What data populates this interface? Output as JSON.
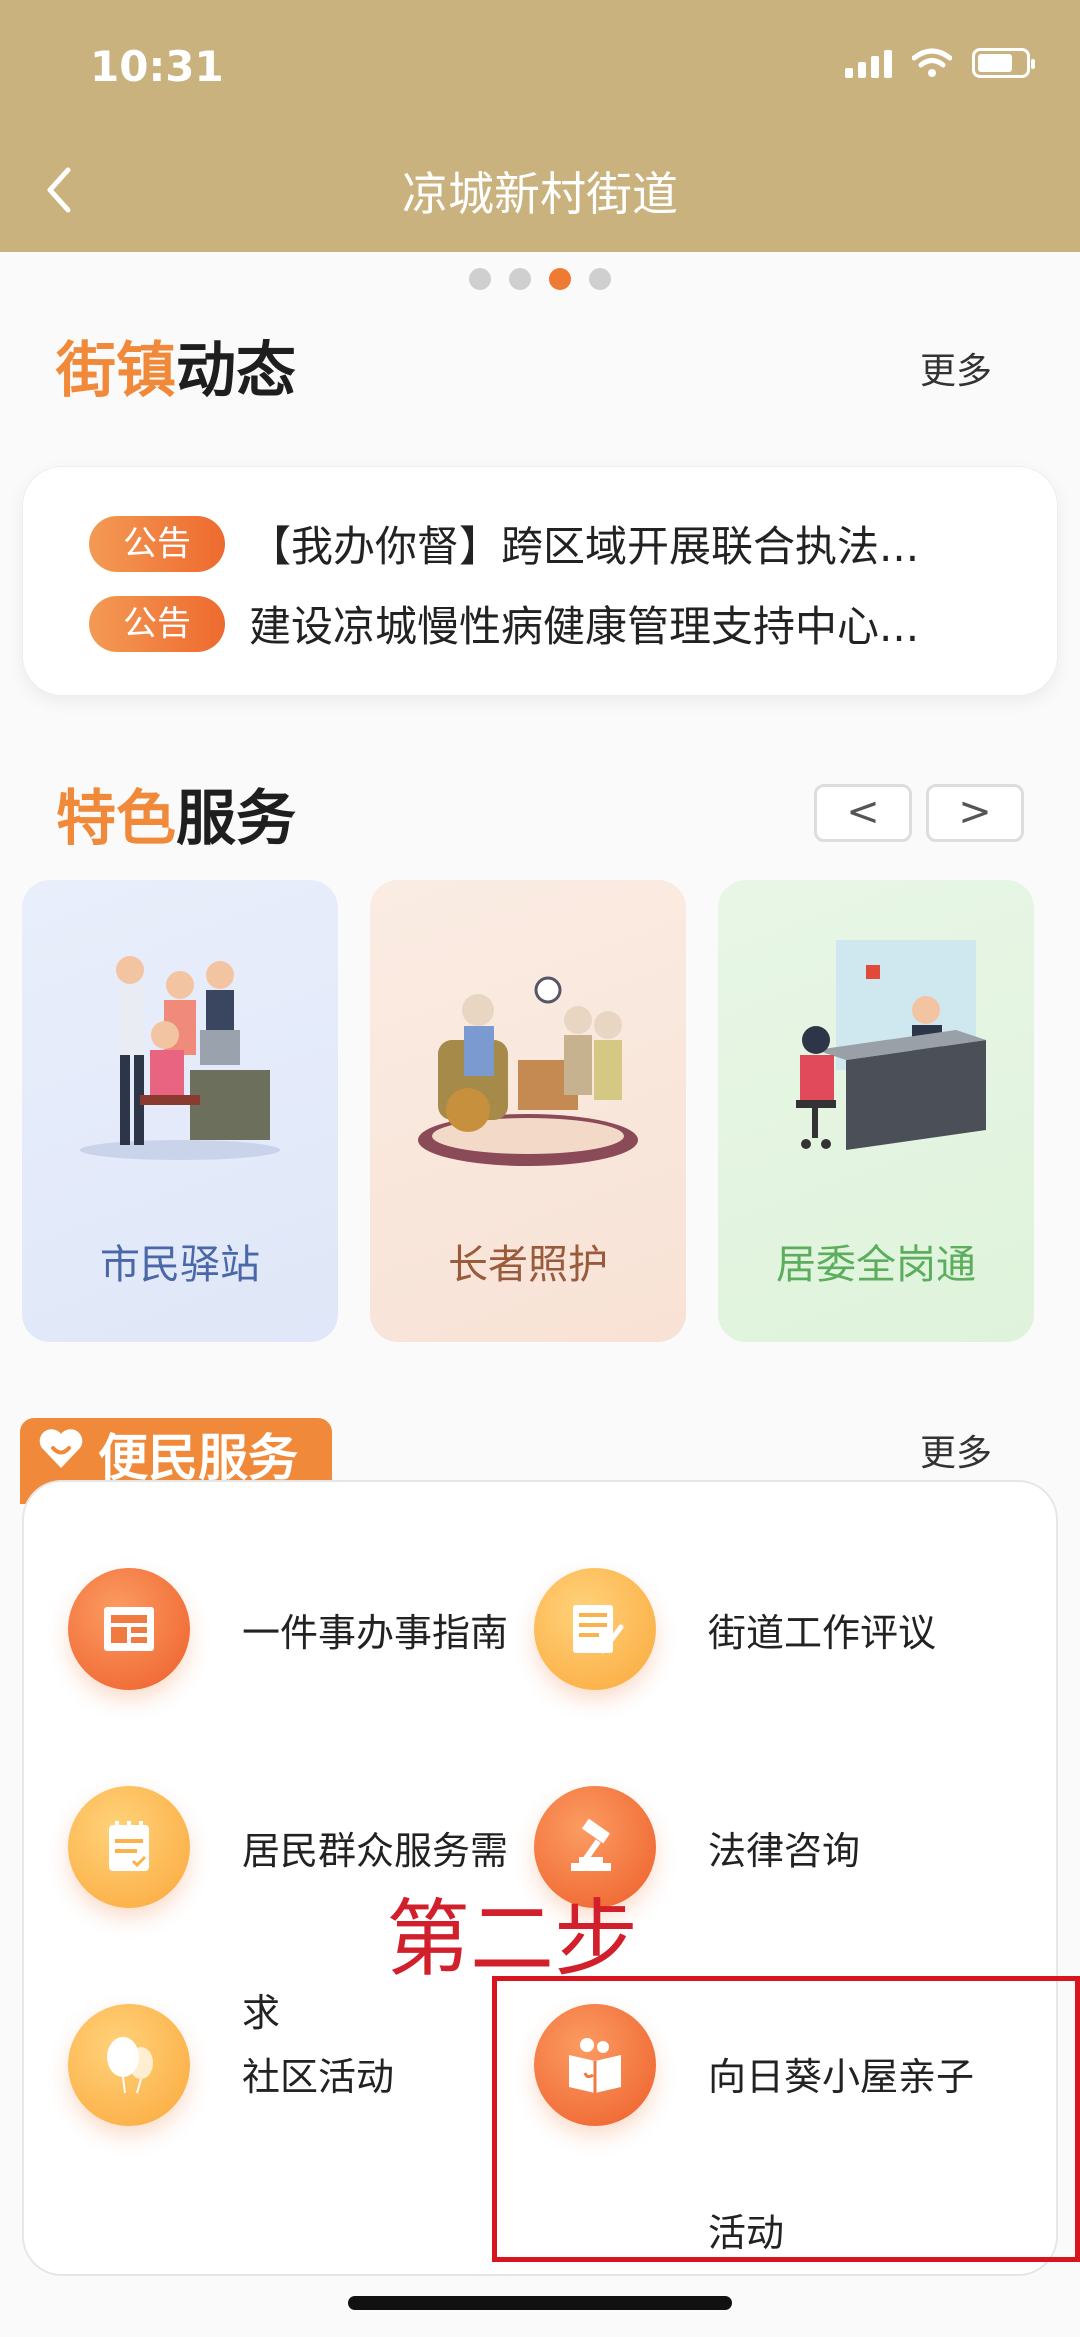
{
  "status_bar": {
    "time": "10:31"
  },
  "header": {
    "title": "凉城新村街道"
  },
  "pager": {
    "count": 4,
    "active_index": 2
  },
  "news_section": {
    "title_accent": "街镇",
    "title_rest": "动态",
    "more_label": "更多",
    "items": [
      {
        "tag": "公告",
        "text": "【我办你督】跨区域开展联合执法..."
      },
      {
        "tag": "公告",
        "text": "建设凉城慢性病健康管理支持中心..."
      }
    ]
  },
  "feature_section": {
    "title_accent": "特色",
    "title_rest": "服务",
    "prev_label": "<",
    "next_label": ">",
    "cards": [
      {
        "label": "市民驿站",
        "color": "#4a68a8"
      },
      {
        "label": "长者照护",
        "color": "#9a5a3c"
      },
      {
        "label": "居委全岗通",
        "color": "#5cae5e"
      }
    ]
  },
  "convenience_section": {
    "title": "便民服务",
    "more_label": "更多",
    "items": [
      {
        "label": "一件事办事指南",
        "icon": "document-icon"
      },
      {
        "label": "街道工作评议",
        "icon": "list-pen-icon"
      },
      {
        "label": "居民群众服务需",
        "label_cont": "求",
        "icon": "notepad-icon"
      },
      {
        "label": "法律咨询",
        "icon": "gavel-icon"
      },
      {
        "label": "社区活动",
        "icon": "balloon-icon"
      },
      {
        "label": "向日葵小屋亲子",
        "label_cont": "活动",
        "icon": "family-book-icon"
      }
    ]
  },
  "annotation": {
    "text": "第二步"
  },
  "colors": {
    "header": "#c9b27d",
    "accent": "#f08a3a",
    "highlight_box": "#d8141f"
  }
}
